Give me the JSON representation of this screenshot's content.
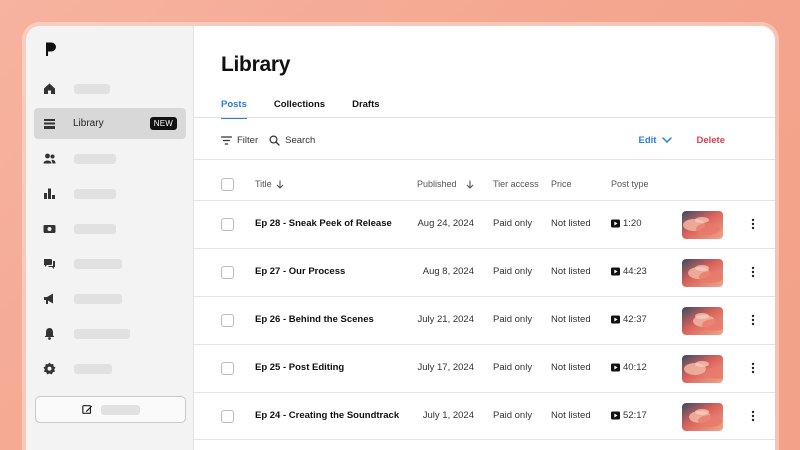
{
  "sidebar": {
    "items": [
      {
        "icon": "home-icon",
        "label": "",
        "skeleton_width": 36
      },
      {
        "icon": "library-icon",
        "label": "Library",
        "badge": "NEW",
        "active": true
      },
      {
        "icon": "members-icon",
        "label": "",
        "skeleton_width": 42
      },
      {
        "icon": "insights-icon",
        "label": "",
        "skeleton_width": 42
      },
      {
        "icon": "payouts-icon",
        "label": "",
        "skeleton_width": 42
      },
      {
        "icon": "chats-icon",
        "label": "",
        "skeleton_width": 48
      },
      {
        "icon": "promotions-icon",
        "label": "",
        "skeleton_width": 48
      },
      {
        "icon": "notifications-icon",
        "label": "",
        "skeleton_width": 56
      },
      {
        "icon": "settings-icon",
        "label": "",
        "skeleton_width": 38
      }
    ],
    "create_button": {
      "icon": "edit-icon"
    }
  },
  "main": {
    "title": "Library",
    "tabs": [
      {
        "label": "Posts",
        "active": true
      },
      {
        "label": "Collections"
      },
      {
        "label": "Drafts"
      }
    ],
    "toolbar": {
      "filter_label": "Filter",
      "search_label": "Search",
      "edit_label": "Edit",
      "delete_label": "Delete"
    },
    "columns": {
      "title": "Title",
      "published": "Published",
      "tier_access": "Tier access",
      "price": "Price",
      "post_type": "Post type"
    },
    "rows": [
      {
        "title": "Ep 28 - Sneak Peek of Release",
        "published": "Aug 24, 2024",
        "tier": "Paid only",
        "price": "Not listed",
        "duration": "1:20"
      },
      {
        "title": "Ep 27 - Our Process",
        "published": "Aug 8, 2024",
        "tier": "Paid only",
        "price": "Not listed",
        "duration": "44:23"
      },
      {
        "title": "Ep 26 - Behind the Scenes",
        "published": "July 21, 2024",
        "tier": "Paid only",
        "price": "Not listed",
        "duration": "42:37"
      },
      {
        "title": "Ep 25 - Post Editing",
        "published": "July 17, 2024",
        "tier": "Paid only",
        "price": "Not listed",
        "duration": "40:12"
      },
      {
        "title": "Ep 24 - Creating the Soundtrack",
        "published": "July 1, 2024",
        "tier": "Paid only",
        "price": "Not listed",
        "duration": "52:17"
      }
    ]
  },
  "colors": {
    "accent": "#2b7fd4",
    "danger": "#d64256",
    "background_gradient": "#f6b39f"
  }
}
